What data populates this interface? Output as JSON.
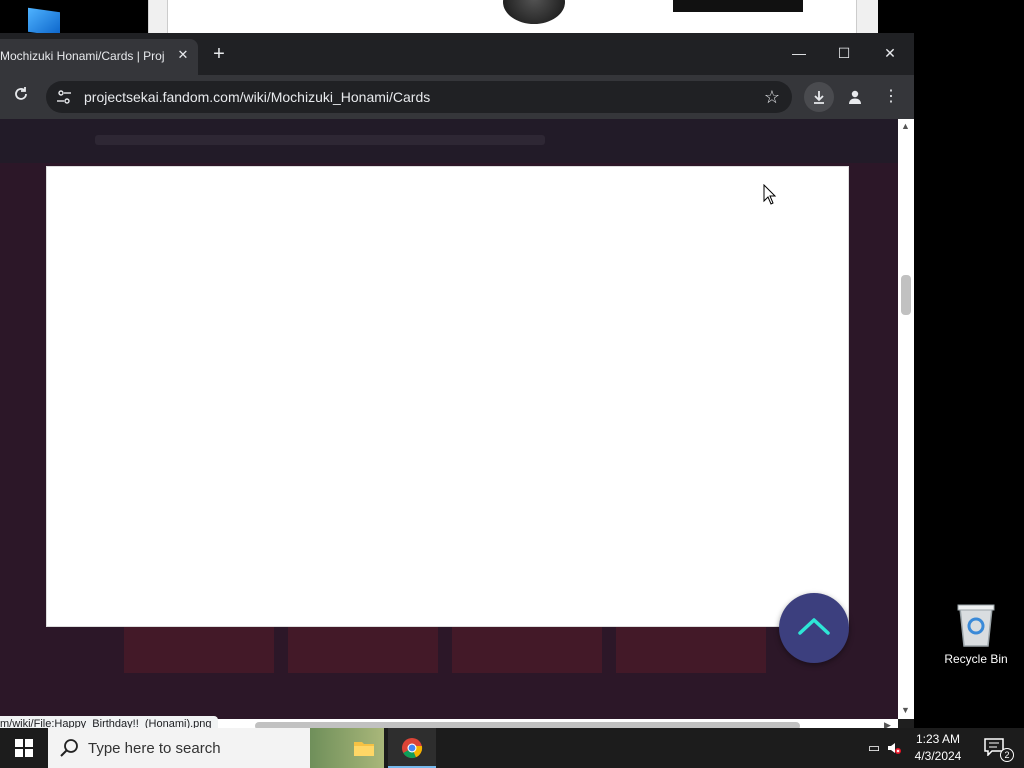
{
  "browser": {
    "tab_title": "Mochizuki Honami/Cards | Proj",
    "tab_close": "✕",
    "new_tab": "+",
    "window_controls": {
      "minimize": "—",
      "maximize": "☐",
      "close": "✕"
    },
    "url": "projectsekai.fandom.com/wiki/Mochizuki_Honami/Cards",
    "status_url": "m/wiki/File:Happy_Birthday!!_(Honami).png",
    "icons": [
      "reload-icon",
      "site-info-icon",
      "bookmark-star-icon",
      "download-icon",
      "profile-icon",
      "menu-icon"
    ]
  },
  "page": {
    "modal": {
      "state": "blank white overlay"
    },
    "scroll_to_top": {
      "icon": "chevron-up-icon",
      "color": "#3c3f7e",
      "accent": "#2ee6d6"
    }
  },
  "desktop": {
    "recycle_bin_label": "Recycle Bin"
  },
  "taskbar": {
    "search_placeholder": "Type here to search",
    "clock_time": "1:23 AM",
    "clock_date": "4/3/2024",
    "notification_count": "2",
    "apps": [
      "file-explorer-icon",
      "chrome-icon"
    ]
  }
}
